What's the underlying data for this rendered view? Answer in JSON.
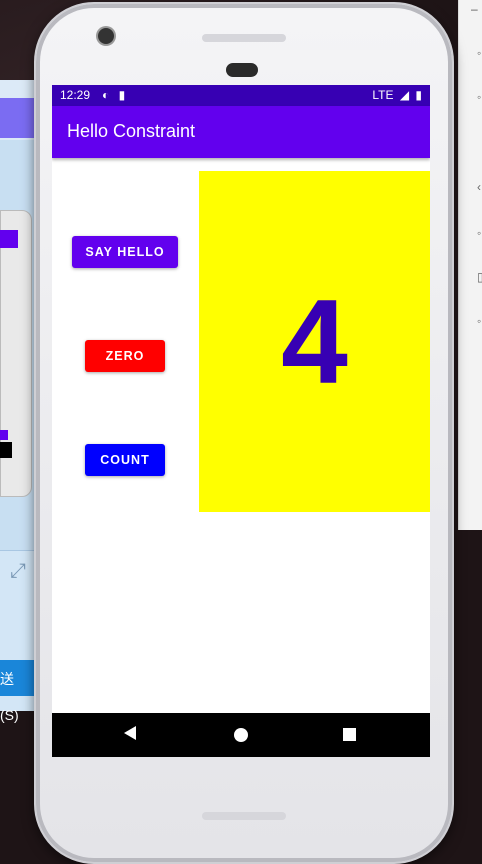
{
  "status_bar": {
    "time": "12:29",
    "left_icons": [
      "p-icon",
      "sd-card-icon"
    ],
    "network": "LTE",
    "signal_icon": "signal-icon",
    "battery_icon": "battery-icon"
  },
  "app_bar": {
    "title": "Hello Constraint"
  },
  "buttons": {
    "say_hello": "SAY HELLO",
    "zero": "ZERO",
    "count": "COUNT"
  },
  "counter": {
    "value": "4"
  },
  "background": {
    "send_button_label": "送(S)"
  },
  "colors": {
    "primary": "#6200ee",
    "primary_dark": "#3700b3",
    "zero_button": "#ff0000",
    "count_button": "#0000ff",
    "count_background": "#ffff00"
  },
  "nav_bar": {
    "back_icon": "back-icon",
    "home_icon": "home-icon",
    "recents_icon": "recents-icon"
  }
}
